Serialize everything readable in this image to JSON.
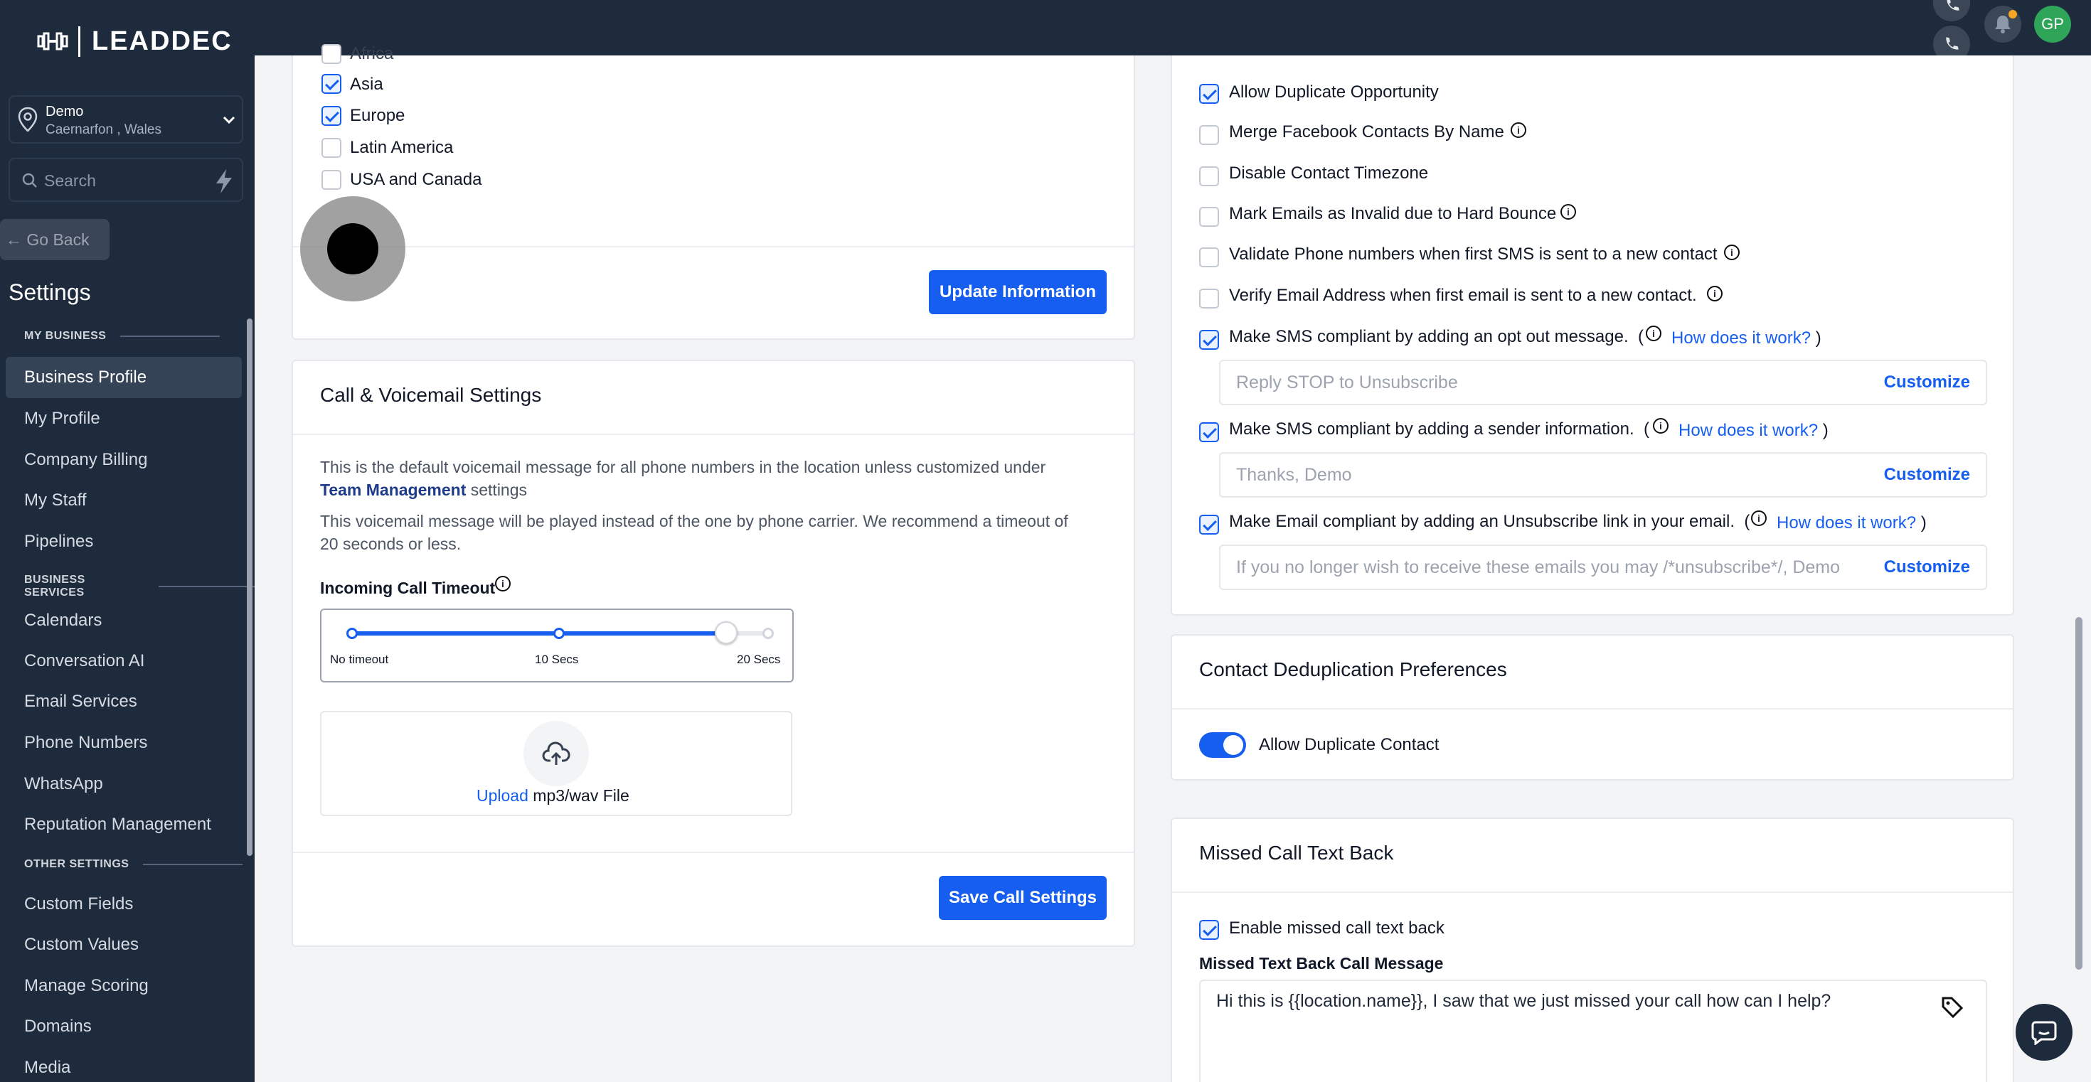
{
  "sidebar": {
    "logo": "LEADDEC",
    "location_name": "Demo",
    "location_address": "Caernarfon , Wales",
    "search_placeholder": "Search",
    "go_back": "Go Back",
    "title": "Settings",
    "sections": {
      "my_business": "MY BUSINESS",
      "business_services": "BUSINESS SERVICES",
      "other_settings": "OTHER SETTINGS"
    },
    "items": [
      {
        "label": "Business Profile",
        "active": true
      },
      {
        "label": "My Profile"
      },
      {
        "label": "Company Billing"
      },
      {
        "label": "My Staff"
      },
      {
        "label": "Pipelines"
      },
      {
        "label": "Calendars"
      },
      {
        "label": "Conversation AI"
      },
      {
        "label": "Email Services"
      },
      {
        "label": "Phone Numbers"
      },
      {
        "label": "WhatsApp"
      },
      {
        "label": "Reputation Management"
      },
      {
        "label": "Custom Fields"
      },
      {
        "label": "Custom Values"
      },
      {
        "label": "Manage Scoring"
      },
      {
        "label": "Domains"
      },
      {
        "label": "Media"
      }
    ]
  },
  "header": {
    "avatar_initials": "GP"
  },
  "regions": {
    "partial_top": "Africa",
    "items": [
      {
        "label": "Asia",
        "checked": true
      },
      {
        "label": "Europe",
        "checked": true
      },
      {
        "label": "Latin America",
        "checked": false
      },
      {
        "label": "USA and Canada",
        "checked": false
      }
    ],
    "update_button": "Update Information"
  },
  "call_settings": {
    "title": "Call & Voicemail Settings",
    "desc1_a": "This is the default voicemail message for all phone numbers in the location unless customized under",
    "desc1_link": "Team Management",
    "desc1_b": "settings",
    "desc2_a": "This voicemail message will be played instead of the one by phone carrier. We recommend a timeout of",
    "desc2_b": "20 seconds or less.",
    "timeout_label": "Incoming Call Timeout",
    "slider_labels": [
      "No timeout",
      "10 Secs",
      "20 Secs"
    ],
    "slider_value_fraction": 0.9,
    "upload_link": "Upload",
    "upload_text": "mp3/wav File",
    "save_button": "Save Call Settings"
  },
  "contact_options": {
    "items": [
      {
        "label": "Allow Duplicate Opportunity",
        "checked": true,
        "info": false
      },
      {
        "label": "Merge Facebook Contacts By Name",
        "checked": false,
        "info": true
      },
      {
        "label": "Disable Contact Timezone",
        "checked": false,
        "info": false
      },
      {
        "label": "Mark Emails as Invalid due to Hard Bounce",
        "checked": false,
        "info": true
      },
      {
        "label": "Validate Phone numbers when first SMS is sent to a new contact",
        "checked": false,
        "info": true
      },
      {
        "label": "Verify Email Address when first email is sent to a new contact.",
        "checked": false,
        "info": true
      }
    ],
    "sms_optout_label": "Make SMS compliant by adding an opt out message.",
    "sms_optout_placeholder": "Reply STOP to Unsubscribe",
    "sms_sender_label": "Make SMS compliant by adding a sender information.",
    "sms_sender_placeholder": "Thanks, Demo",
    "email_unsub_label": "Make Email compliant by adding an Unsubscribe link in your email.",
    "email_unsub_placeholder": "If you no longer wish to receive these emails you may /*unsubscribe*/, Demo",
    "how_link": "How does it work?",
    "open_paren": "(",
    "close_paren": ")",
    "customize": "Customize"
  },
  "dedup": {
    "title": "Contact Deduplication Preferences",
    "toggle_label": "Allow Duplicate Contact",
    "toggle_on": true
  },
  "missed_call": {
    "title": "Missed Call Text Back",
    "enable_label": "Enable missed call text back",
    "message_label": "Missed Text Back Call Message",
    "message": "Hi this is {{location.name}}, I saw that we just missed your call how can I help?"
  }
}
